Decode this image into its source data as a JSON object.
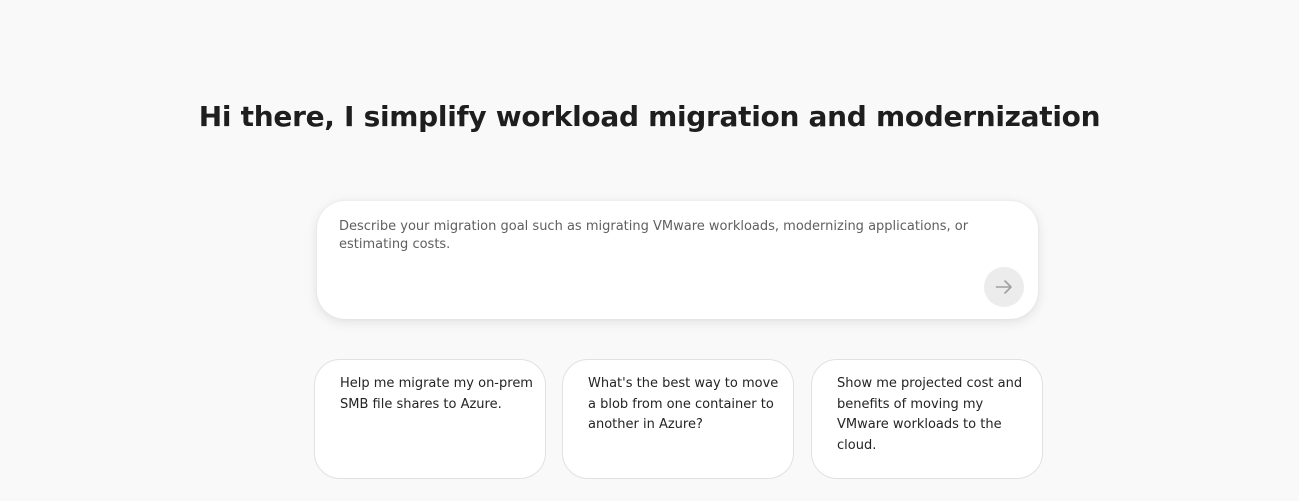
{
  "hero": {
    "title": "Hi there, I simplify workload migration and modernization"
  },
  "prompt": {
    "placeholder": "Describe your migration goal such as migrating VMware workloads, modernizing applications, or estimating costs.",
    "value": "",
    "send_icon": "arrow-right-icon"
  },
  "suggestions": [
    {
      "text": "Help me migrate my on-prem SMB file shares to Azure."
    },
    {
      "text": "What's the best way to move a blob from one container to another in Azure?"
    },
    {
      "text": "Show me projected cost and benefits of moving my VMware workloads to the cloud."
    }
  ]
}
